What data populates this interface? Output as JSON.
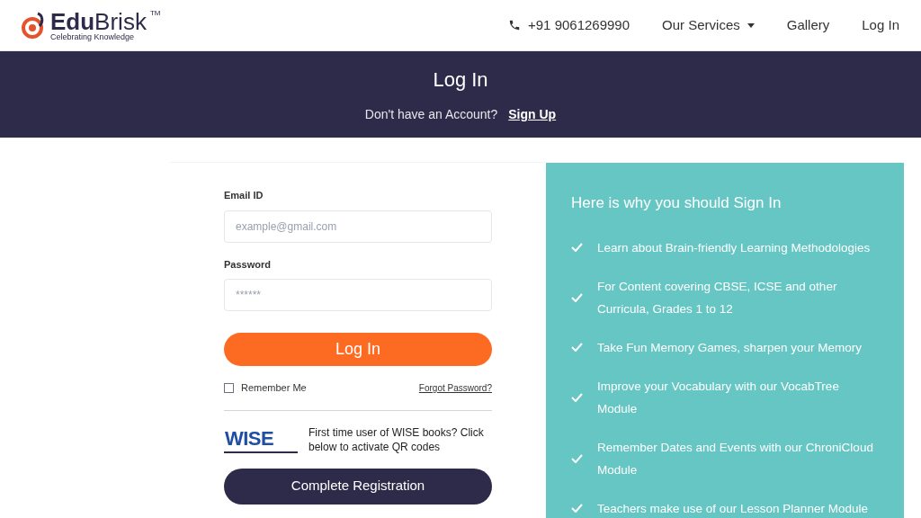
{
  "header": {
    "logo": {
      "part_1": "Edu",
      "part_2": "Brisk",
      "trademark": "TM",
      "tagline": "Celebrating Knowledge"
    },
    "phone": "+91 9061269990",
    "nav": [
      {
        "label": "Our Services",
        "kind": "dropdown"
      },
      {
        "label": "Gallery",
        "kind": "link"
      },
      {
        "label": "Log In",
        "kind": "link"
      }
    ]
  },
  "banner": {
    "title": "Log In",
    "prompt": "Don't have an Account?",
    "link": "Sign Up"
  },
  "form": {
    "email": {
      "label": "Email ID",
      "placeholder": "example@gmail.com"
    },
    "password": {
      "label": "Password",
      "placeholder": "******"
    },
    "submit": "Log In",
    "remember": {
      "label": "Remember Me",
      "checked": false
    },
    "forgot": "Forgot Password?",
    "wise": {
      "logo": "WISE",
      "text": "First time user of WISE books? Click below to activate QR codes"
    },
    "register": "Complete Registration"
  },
  "benefits": {
    "title": "Here is why you should Sign In",
    "items": [
      "Learn about Brain-friendly Learning Methodologies",
      "For Content covering CBSE, ICSE and other Curricula, Grades 1 to 12",
      "Take Fun Memory Games, sharpen your Memory",
      "Improve your Vocabulary with our VocabTree Module",
      "Remember Dates and Events with our ChroniCloud Module",
      "Teachers make use of our Lesson Planner Module"
    ]
  }
}
